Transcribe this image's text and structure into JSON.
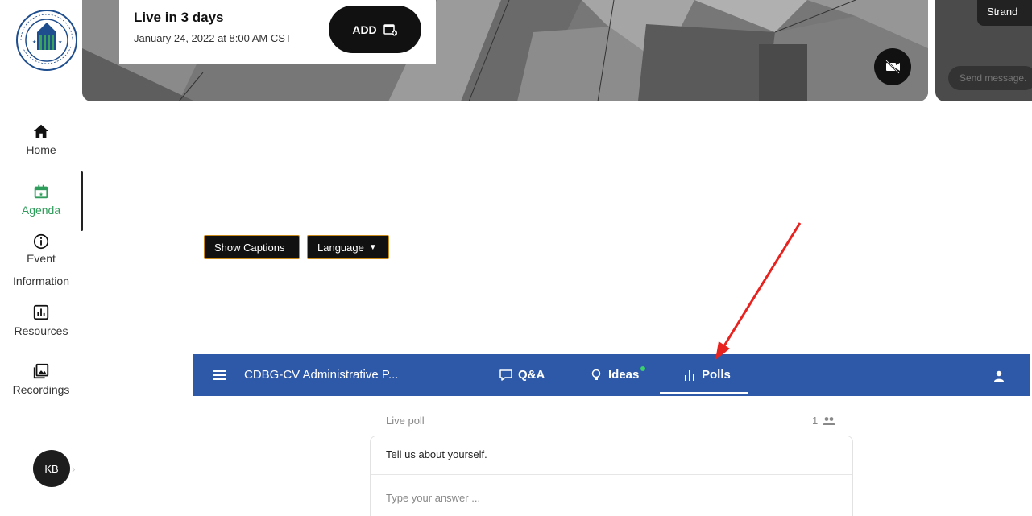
{
  "sidebar": {
    "items": [
      {
        "label": "Home",
        "icon": "home-icon"
      },
      {
        "label": "Agenda",
        "icon": "calendar-icon"
      },
      {
        "label": "Event",
        "label2": "Information",
        "icon": "info-icon"
      },
      {
        "label": "Resources",
        "icon": "chart-box-icon"
      },
      {
        "label": "Recordings",
        "icon": "image-library-icon"
      }
    ],
    "avatar_initials": "KB",
    "active_color": "#2e9c5a"
  },
  "banner": {
    "live_title": "Live in 3 days",
    "live_date": "January 24, 2022 at 8:00 AM CST",
    "add_label": "ADD"
  },
  "chat": {
    "strand_label": "Strand",
    "send_placeholder": "Send message..."
  },
  "captions": {
    "show_label": "Show Captions",
    "language_label": "Language"
  },
  "slido": {
    "bar_color": "#2e59a8",
    "event_title": "CDBG-CV Administrative P...",
    "tabs": [
      {
        "label": "Q&A",
        "icon": "chat-bubble-icon"
      },
      {
        "label": "Ideas",
        "icon": "lightbulb-icon"
      },
      {
        "label": "Polls",
        "icon": "bar-chart-icon",
        "active": true
      }
    ]
  },
  "poll": {
    "status_label": "Live poll",
    "participant_count": "1",
    "question": "Tell us about yourself.",
    "answer_placeholder": "Type your answer ..."
  }
}
